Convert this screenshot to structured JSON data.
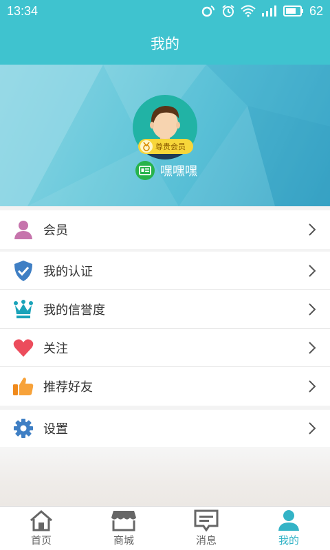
{
  "status_bar": {
    "time": "13:34",
    "battery": "62"
  },
  "header": {
    "title": "我的"
  },
  "profile": {
    "badge": "尊贵会员",
    "username": "嘿嘿嘿"
  },
  "menu": {
    "member": "会员",
    "certification": "我的认证",
    "credit": "我的信誉度",
    "follow": "关注",
    "recommend": "推荐好友",
    "settings": "设置"
  },
  "tabs": {
    "home": "首页",
    "shop": "商城",
    "messages": "消息",
    "mine": "我的"
  },
  "colors": {
    "accent": "#3fc3cf",
    "tab_active": "#33b3c6"
  }
}
